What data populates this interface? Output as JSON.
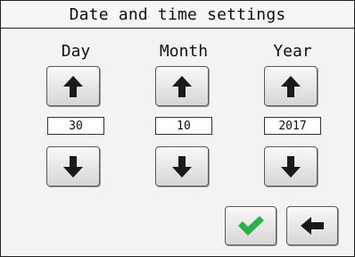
{
  "window": {
    "title": "Date and time settings"
  },
  "columns": [
    {
      "label": "Day",
      "value": "30"
    },
    {
      "label": "Month",
      "value": "10"
    },
    {
      "label": "Year",
      "value": "2017"
    }
  ],
  "icons": {
    "increment": "arrow-up-icon",
    "decrement": "arrow-down-icon",
    "confirm": "checkmark-icon",
    "back": "arrow-left-icon"
  },
  "colors": {
    "confirm_check": "#2db04a",
    "arrow": "#1a1a1a"
  }
}
